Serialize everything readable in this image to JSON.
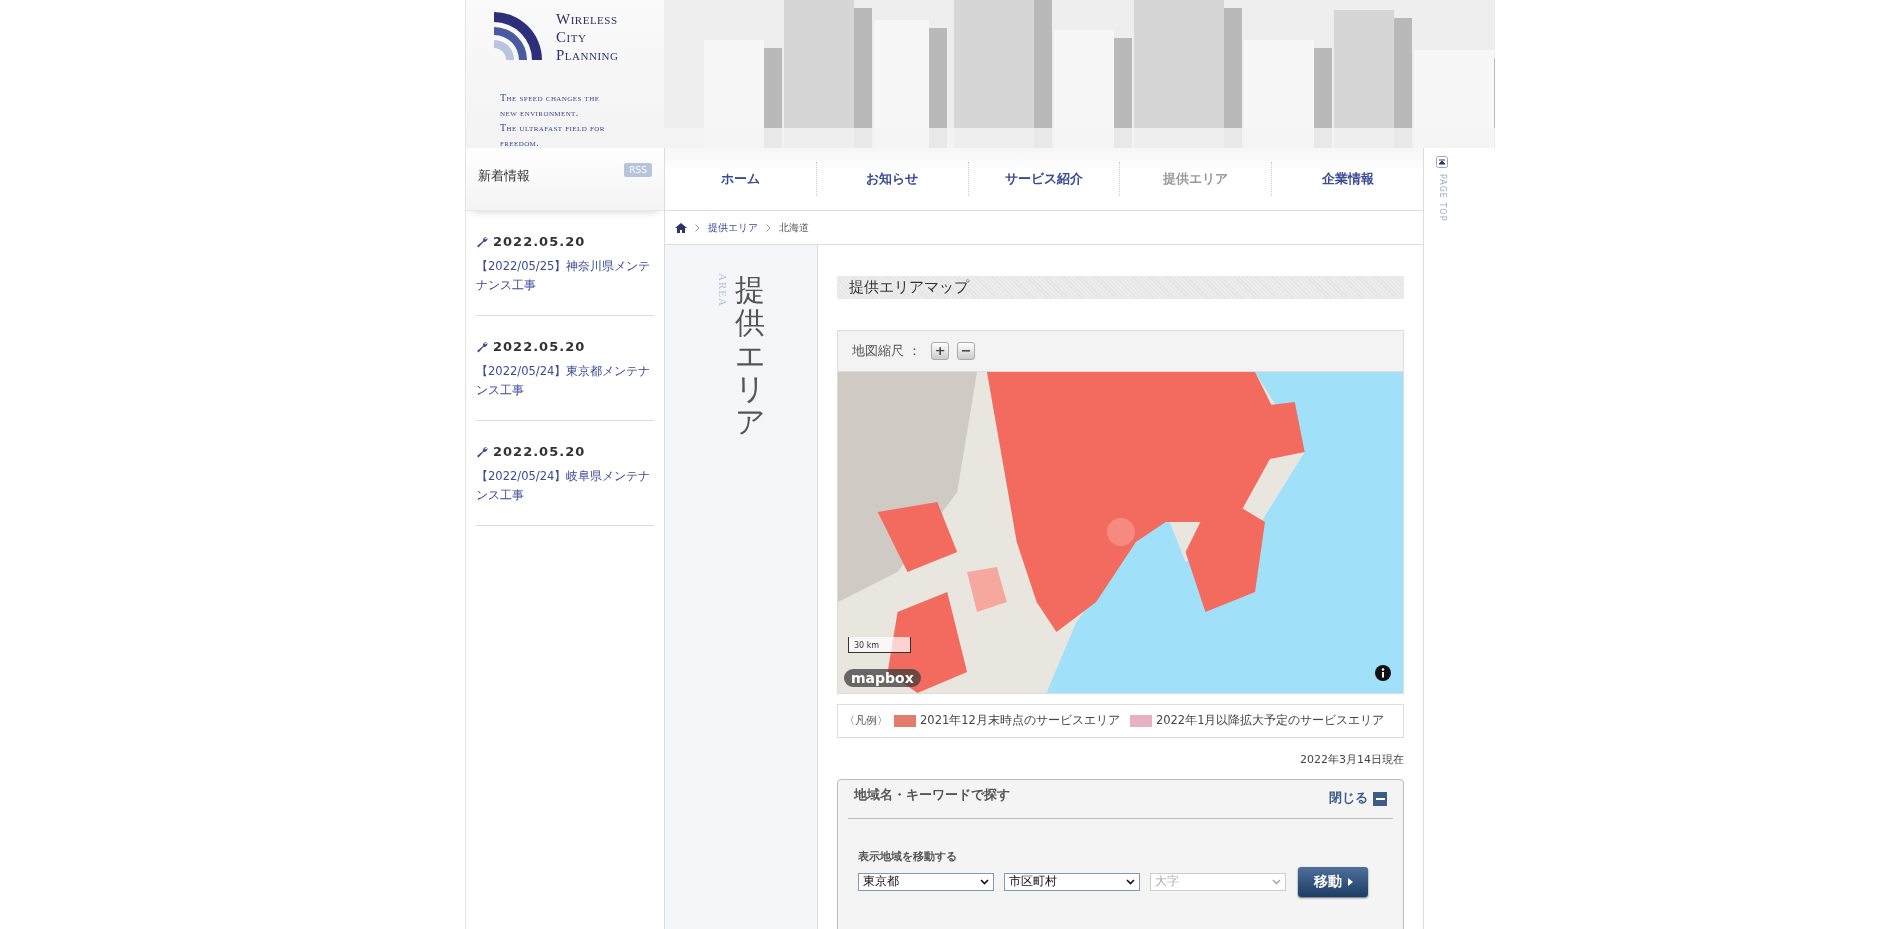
{
  "logo": {
    "lines": [
      "Wireless",
      "City",
      "Planning"
    ]
  },
  "tagline": [
    "The speed changes the",
    "new environment.",
    "The ultrafast field for",
    "freedom."
  ],
  "news": {
    "title": "新着情報",
    "rss": "RSS",
    "items": [
      {
        "date": "2022.05.20",
        "title": "【2022/05/25】神奈川県メンテナンス工事"
      },
      {
        "date": "2022.05.20",
        "title": "【2022/05/24】東京都メンテナンス工事"
      },
      {
        "date": "2022.05.20",
        "title": "【2022/05/24】岐阜県メンテナンス工事"
      }
    ]
  },
  "nav": [
    {
      "label": "ホーム",
      "selected": false
    },
    {
      "label": "お知らせ",
      "selected": false
    },
    {
      "label": "サービス紹介",
      "selected": false
    },
    {
      "label": "提供エリア",
      "selected": true
    },
    {
      "label": "企業情報",
      "selected": false
    }
  ],
  "breadcrumb": [
    {
      "label": "提供エリア",
      "current": false
    },
    {
      "label": "北海道",
      "current": true
    }
  ],
  "side": {
    "label_en": "AREA",
    "title": "提供エリア"
  },
  "section_title": "提供エリアマップ",
  "map": {
    "scale_label": "地図縮尺 ：",
    "zoom_in": "+",
    "zoom_out": "−",
    "scale_bar": "30 km",
    "attribution": "mapbox"
  },
  "legend": {
    "label": "〈凡例〉",
    "items": [
      {
        "color": "#e27c6c",
        "label": "2021年12月末時点のサービスエリア"
      },
      {
        "color": "#e8b1c0",
        "label": "2022年1月以降拡大予定のサービスエリア"
      }
    ]
  },
  "as_of": "2022年3月14日現在",
  "search": {
    "title": "地域名・キーワードで探す",
    "close": "閉じる",
    "move_label": "表示地域を移動する",
    "selects": [
      {
        "value": "東京都",
        "disabled": false
      },
      {
        "value": "市区町村",
        "disabled": false
      },
      {
        "value": "大字",
        "disabled": true
      }
    ],
    "button": "移動"
  },
  "page_top": "PAGE TOP"
}
